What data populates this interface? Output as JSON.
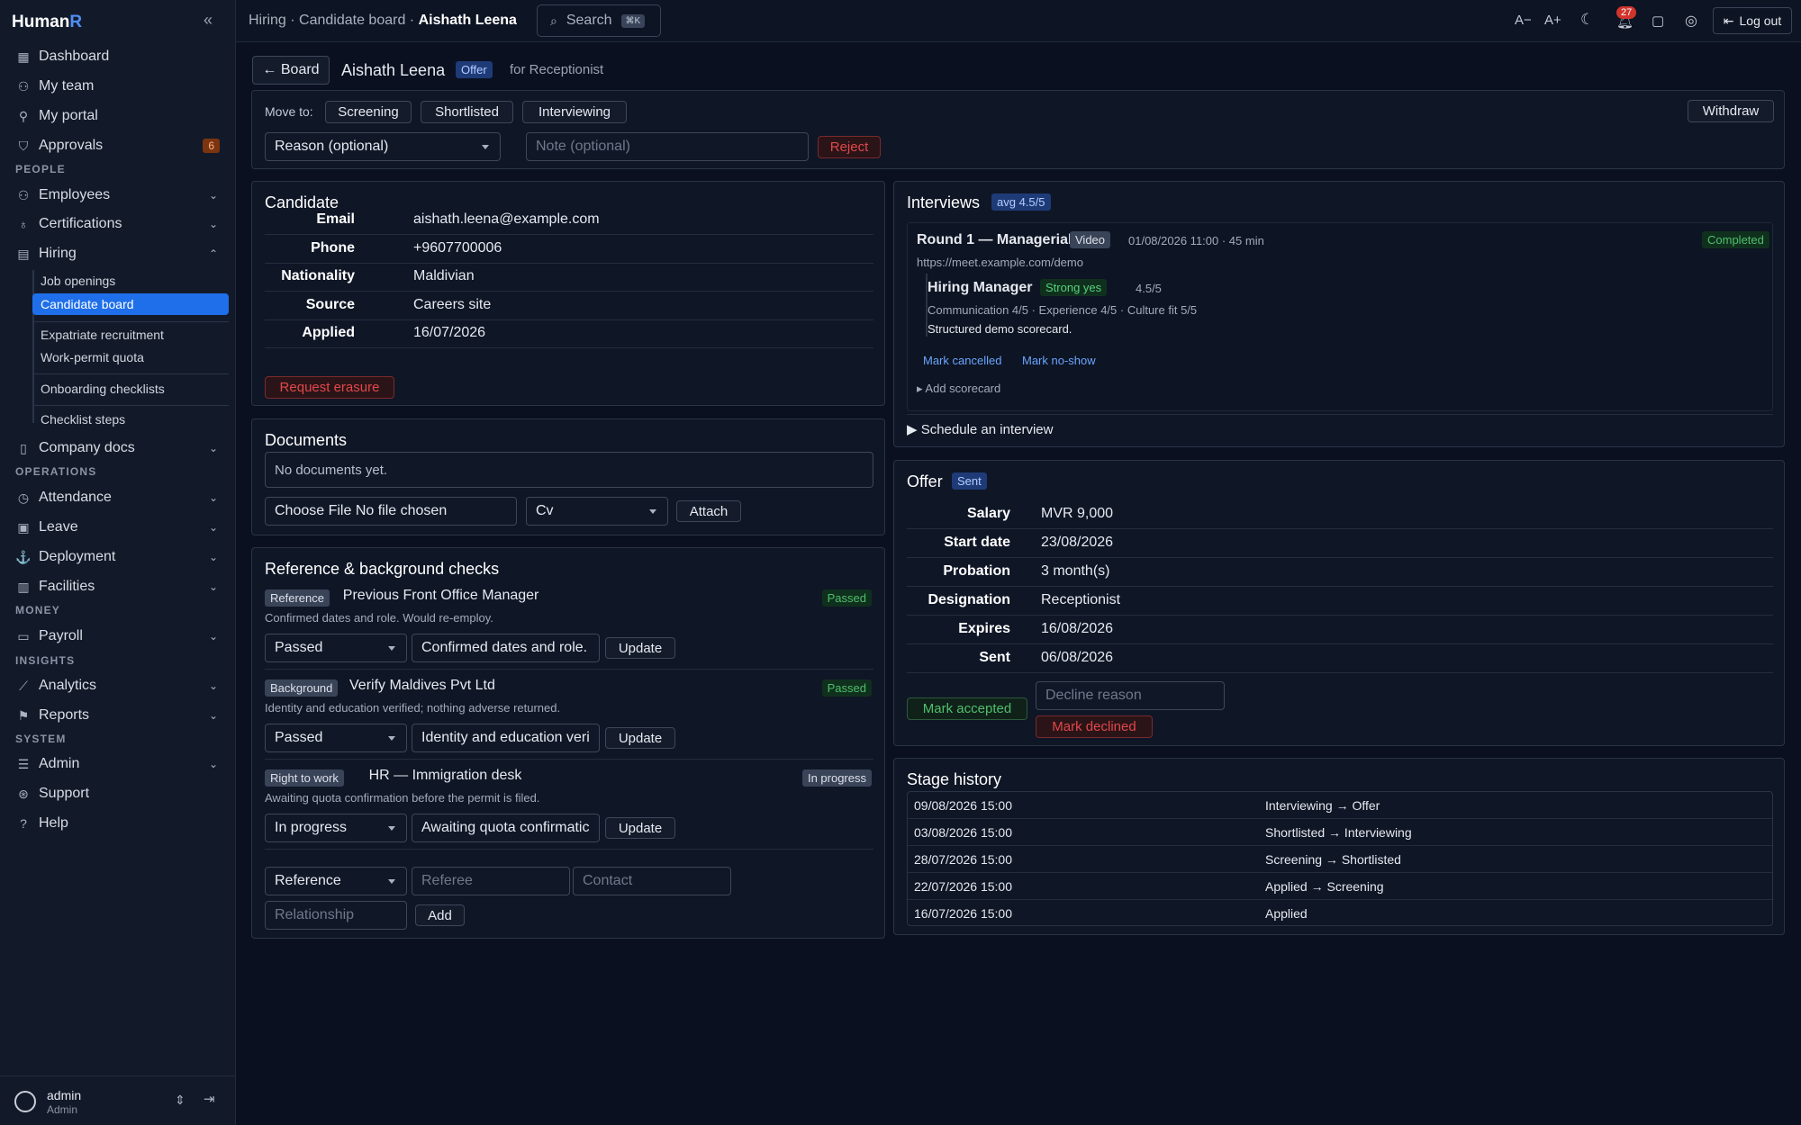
{
  "app": {
    "logo_text": "Human",
    "logo_accent": "R",
    "collapse_glyph": "«"
  },
  "nav": {
    "dashboard": "Dashboard",
    "my_team": "My team",
    "my_portal": "My portal",
    "approvals": "Approvals",
    "approvals_count": "6",
    "sec_people": "PEOPLE",
    "employees": "Employees",
    "certifications": "Certifications",
    "hiring": "Hiring",
    "job_openings": "Job openings",
    "candidate_board": "Candidate board",
    "expatriate_recruitment": "Expatriate recruitment",
    "work_permit_quota": "Work-permit quota",
    "onboarding_checklists": "Onboarding checklists",
    "checklist_steps": "Checklist steps",
    "company_docs": "Company docs",
    "sec_operations": "OPERATIONS",
    "attendance": "Attendance",
    "leave": "Leave",
    "deployment": "Deployment",
    "facilities": "Facilities",
    "sec_money": "MONEY",
    "payroll": "Payroll",
    "sec_insights": "INSIGHTS",
    "analytics": "Analytics",
    "reports": "Reports",
    "sec_system": "SYSTEM",
    "admin": "Admin",
    "support": "Support",
    "help": "Help"
  },
  "user": {
    "name": "admin",
    "role": "Admin"
  },
  "topbar": {
    "crumb_hiring": "Hiring",
    "crumb_sep": "·",
    "crumb_board": "Candidate board",
    "crumb_current": "Aishath Leena",
    "search_label": "Search",
    "search_kbd": "⌘K",
    "font_down": "A−",
    "font_up": "A+",
    "notif_count": "27",
    "logout": "Log out"
  },
  "header": {
    "back": "← Board",
    "name": "Aishath Leena",
    "stage_badge": "Offer",
    "for_role": "for Receptionist"
  },
  "move": {
    "label": "Move to:",
    "screening": "Screening",
    "shortlisted": "Shortlisted",
    "interviewing": "Interviewing",
    "withdraw": "Withdraw",
    "reason_placeholder": "Reason (optional)",
    "note_placeholder": "Note (optional)",
    "reject": "Reject"
  },
  "candidate": {
    "title": "Candidate",
    "rows": [
      {
        "label": "Email",
        "value": "aishath.leena@example.com"
      },
      {
        "label": "Phone",
        "value": "+9607700006"
      },
      {
        "label": "Nationality",
        "value": "Maldivian"
      },
      {
        "label": "Source",
        "value": "Careers site"
      },
      {
        "label": "Applied",
        "value": "16/07/2026"
      }
    ],
    "erasure": "Request erasure"
  },
  "documents": {
    "title": "Documents",
    "empty": "No documents yet.",
    "file_input": "Choose File  No file chosen",
    "type": "Cv",
    "attach": "Attach"
  },
  "checks": {
    "title": "Reference & background checks",
    "items": [
      {
        "kind": "Reference",
        "name": "Previous Front Office Manager",
        "status": "Passed",
        "note": "Confirmed dates and role. Would re-employ.",
        "select": "Passed",
        "summary": "Confirmed dates and role.",
        "update": "Update"
      },
      {
        "kind": "Background",
        "name": "Verify Maldives Pvt Ltd",
        "status": "Passed",
        "note": "Identity and education verified; nothing adverse returned.",
        "select": "Passed",
        "summary": "Identity and education veri",
        "update": "Update"
      },
      {
        "kind": "Right to work",
        "name": "HR — Immigration desk",
        "status": "In progress",
        "note": "Awaiting quota confirmation before the permit is filed.",
        "select": "In progress",
        "summary": "Awaiting quota confirmatic",
        "update": "Update"
      }
    ],
    "new_type": "Reference",
    "referee_ph": "Referee",
    "contact_ph": "Contact",
    "relationship_ph": "Relationship",
    "add": "Add"
  },
  "interviews": {
    "title": "Interviews",
    "avg": "avg 4.5/5",
    "round_title": "Round 1 — Managerial",
    "mode": "Video",
    "when": "01/08/2026 11:00 · 45 min",
    "status": "Completed",
    "url": "https://meet.example.com/demo",
    "reviewer": "Hiring Manager",
    "verdict": "Strong yes",
    "score": "4.5/5",
    "breakdown": "Communication 4/5 · Experience 4/5 · Culture fit 5/5",
    "comment": "Structured demo scorecard.",
    "mark_cancelled": "Mark cancelled",
    "mark_noshow": "Mark no-show",
    "add_scorecard": "▸ Add scorecard",
    "schedule": "▶ Schedule an interview"
  },
  "offer": {
    "title": "Offer",
    "status": "Sent",
    "rows": [
      {
        "label": "Salary",
        "value": "MVR 9,000"
      },
      {
        "label": "Start date",
        "value": "23/08/2026"
      },
      {
        "label": "Probation",
        "value": "3 month(s)"
      },
      {
        "label": "Designation",
        "value": "Receptionist"
      },
      {
        "label": "Expires",
        "value": "16/08/2026"
      },
      {
        "label": "Sent",
        "value": "06/08/2026"
      }
    ],
    "mark_accepted": "Mark accepted",
    "decline_ph": "Decline reason",
    "mark_declined": "Mark declined"
  },
  "history": {
    "title": "Stage history",
    "rows": [
      {
        "when": "09/08/2026 15:00",
        "change": "Interviewing → Offer"
      },
      {
        "when": "03/08/2026 15:00",
        "change": "Shortlisted → Interviewing"
      },
      {
        "when": "28/07/2026 15:00",
        "change": "Screening → Shortlisted"
      },
      {
        "when": "22/07/2026 15:00",
        "change": "Applied → Screening"
      },
      {
        "when": "16/07/2026 15:00",
        "change": "Applied"
      }
    ]
  }
}
